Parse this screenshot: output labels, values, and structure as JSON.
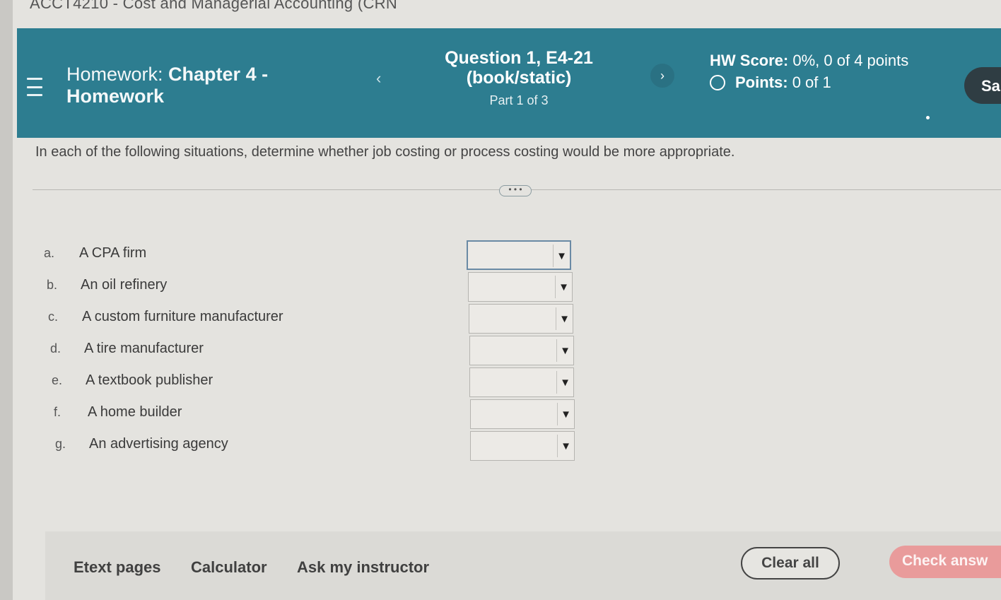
{
  "course": {
    "title": "ACCT4210 - Cost and Managerial Accounting (CRN"
  },
  "header": {
    "hw_prefix": "Homework:",
    "hw_name_line1": "Chapter 4 -",
    "hw_name_line2": "Homework",
    "question_line1": "Question 1, E4-21",
    "question_line2": "(book/static)",
    "part": "Part 1 of 3",
    "hw_score_label": "HW Score:",
    "hw_score_value": "0%, 0 of 4 points",
    "points_label": "Points:",
    "points_value": "0 of 1",
    "save_label": "Sa",
    "prev_icon": "chevron-left-icon",
    "next_icon": "chevron-right-icon"
  },
  "question": {
    "instructions": "In each of the following situations, determine whether job costing or process costing would be more appropriate.",
    "expand_label": "• • •",
    "items": [
      {
        "letter": "a.",
        "text": "A CPA firm",
        "selected": ""
      },
      {
        "letter": "b.",
        "text": "An oil refinery",
        "selected": ""
      },
      {
        "letter": "c.",
        "text": "A custom furniture manufacturer",
        "selected": ""
      },
      {
        "letter": "d.",
        "text": "A tire manufacturer",
        "selected": ""
      },
      {
        "letter": "e.",
        "text": "A textbook publisher",
        "selected": ""
      },
      {
        "letter": "f.",
        "text": "A home builder",
        "selected": ""
      },
      {
        "letter": "g.",
        "text": "An advertising agency",
        "selected": ""
      }
    ],
    "dropdown_arrow": "▼"
  },
  "footer": {
    "etext": "Etext pages",
    "calculator": "Calculator",
    "ask": "Ask my instructor",
    "clear": "Clear all",
    "check": "Check answ"
  },
  "colors": {
    "header_bg": "#2d7d90",
    "page_bg": "#e4e3df",
    "check_btn": "#e99b9b",
    "save_btn": "#2f3d43"
  }
}
